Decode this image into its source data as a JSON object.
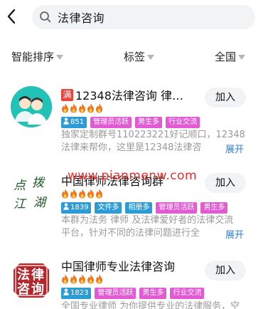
{
  "search": {
    "query": "法律咨询"
  },
  "filters": [
    {
      "label": "智能排序"
    },
    {
      "label": "标签"
    },
    {
      "label": "全国"
    }
  ],
  "groups": [
    {
      "full_badge": "满",
      "name": "12348法律咨询 律…",
      "flames": 5,
      "tags": [
        {
          "text": "851",
          "kind": "count"
        },
        {
          "text": "管理员活跃",
          "kind": "mag"
        },
        {
          "text": "男生多",
          "kind": "mag"
        },
        {
          "text": "行业交流",
          "kind": "mag"
        }
      ],
      "desc_line1": "独家定制群号110223221好记顺口，12348",
      "desc_line2": "法律来帮你，这里是12348法律咨",
      "expand": "展开",
      "join": "加入"
    },
    {
      "full_badge": "",
      "name": "中国律师法律咨询群",
      "flames": 5,
      "tags": [
        {
          "text": "1839",
          "kind": "count"
        },
        {
          "text": "文件多",
          "kind": "blue"
        },
        {
          "text": "相册多",
          "kind": "blue"
        },
        {
          "text": "管理员活跃",
          "kind": "mag"
        },
        {
          "text": "男生多",
          "kind": "mag"
        }
      ],
      "desc_line1": "本群为法务 律师 及法律爱好者的法律交流",
      "desc_line2": "平台，针对不同的法律问题进行全",
      "expand": "展开",
      "join": "加入"
    },
    {
      "full_badge": "",
      "name": "中国律师专业法律咨询",
      "flames": 5,
      "tags": [
        {
          "text": "1823",
          "kind": "count"
        },
        {
          "text": "管理员活跃",
          "kind": "mag"
        },
        {
          "text": "男生多",
          "kind": "mag"
        },
        {
          "text": "行业交流",
          "kind": "mag"
        }
      ],
      "desc_line1": "全国专业律师 为你提供专业的法律服务，空",
      "desc_line2": "",
      "expand": "",
      "join": "加入"
    }
  ],
  "avatars": {
    "group2_calligraphy": [
      "点",
      "拨",
      "江",
      "湖"
    ],
    "group3_seal": [
      "法",
      "律",
      "咨",
      "询"
    ]
  },
  "watermark": "www.pianmenw.com",
  "colors": {
    "accent_blue": "#2d9cd6",
    "tag_magenta": "#e25bd2",
    "full_red": "#e8433c",
    "flame_orange": "#f5751f",
    "link_blue": "#2d7fd6"
  }
}
